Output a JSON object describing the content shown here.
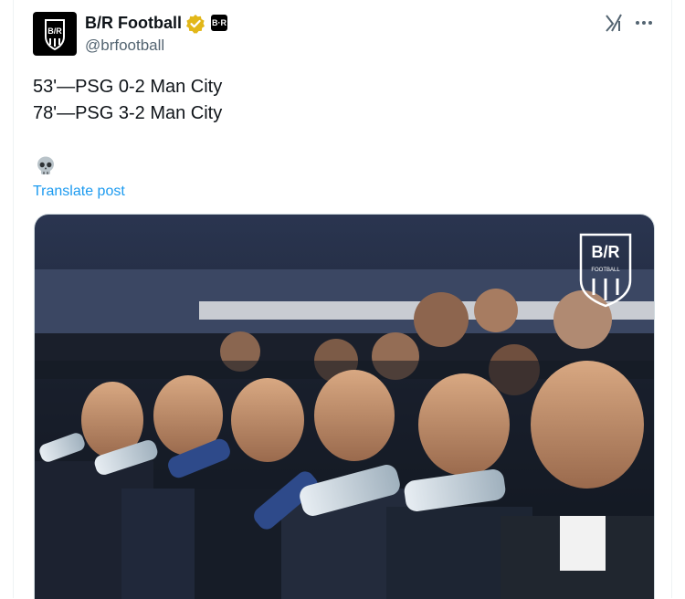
{
  "tweet": {
    "author_name": "B/R Football",
    "author_handle": "@brfootball",
    "affiliate_badge": "B·R",
    "lines": [
      "53'—PSG 0-2 Man City",
      "78'—PSG 3-2 Man City"
    ],
    "emoji": "💀",
    "translate_label": "Translate post",
    "avatar_logo": "B/R"
  },
  "media": {
    "watermark_top": "B/R",
    "watermark_sub": "FOOTBALL"
  },
  "icons": {
    "verified": "verified-gold-badge",
    "grok": "grok-icon",
    "more": "more-horizontal-icon",
    "skull": "skull-emoji"
  },
  "colors": {
    "verified_gold": "#e2b719",
    "link_blue": "#1d9bf0",
    "secondary_text": "#536471"
  }
}
